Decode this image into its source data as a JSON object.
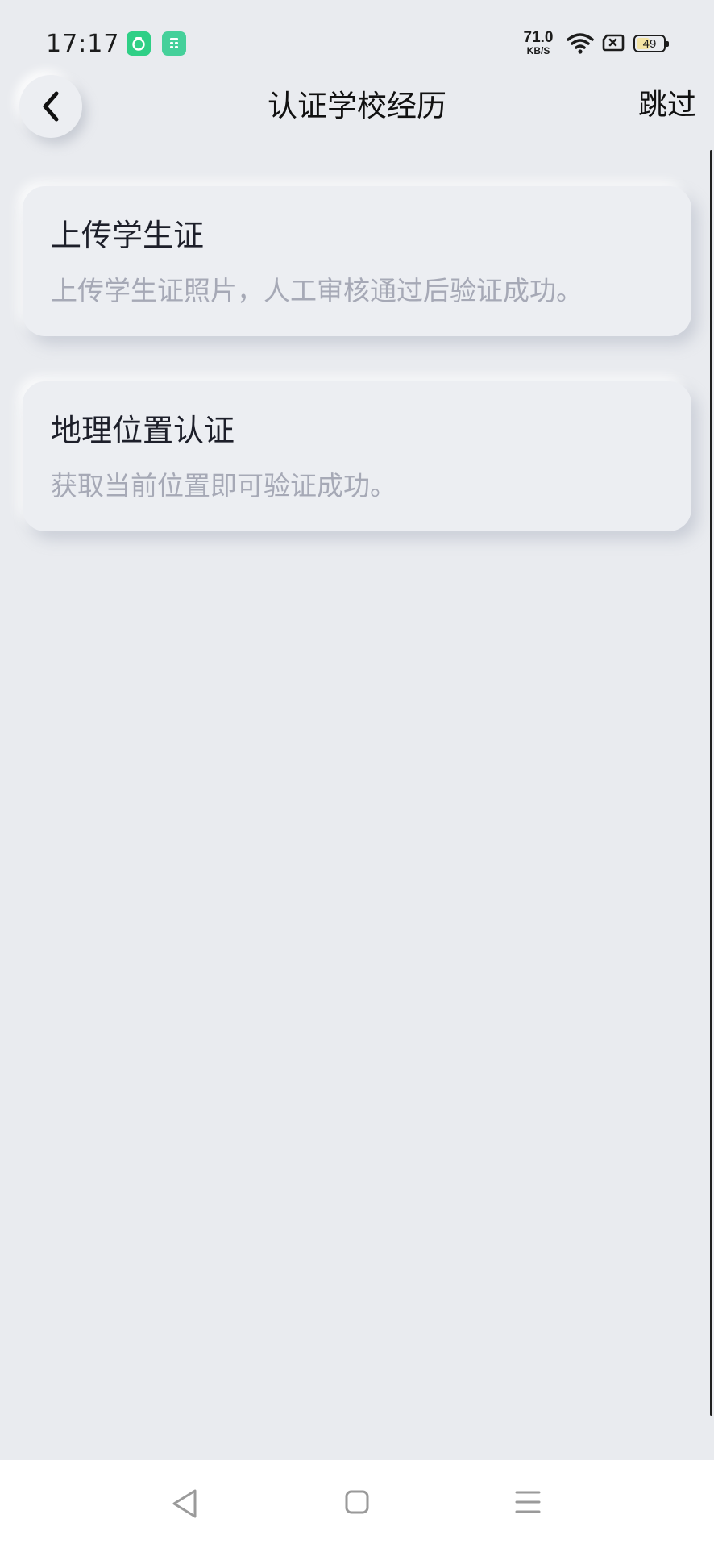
{
  "status_bar": {
    "time": "17:17",
    "net_speed_value": "71.0",
    "net_speed_unit": "KB/S",
    "battery_level": "49",
    "icons": [
      "app-badge-icon",
      "app-badge-icon",
      "wifi-icon",
      "sim-icon",
      "battery-icon"
    ]
  },
  "header": {
    "title": "认证学校经历",
    "skip_label": "跳过",
    "back_icon": "chevron-left-icon"
  },
  "options": [
    {
      "title": "上传学生证",
      "description": "上传学生证照片，人工审核通过后验证成功。"
    },
    {
      "title": "地理位置认证",
      "description": "获取当前位置即可验证成功。"
    }
  ],
  "system_nav": {
    "icons": [
      "triangle-back-icon",
      "square-home-icon",
      "menu-lines-icon"
    ]
  },
  "colors": {
    "background": "#e9ebef",
    "card": "#eceef2",
    "title_text": "#1d1f2a",
    "desc_text": "#a6a9b6",
    "app_badge": "#2fcf86"
  }
}
